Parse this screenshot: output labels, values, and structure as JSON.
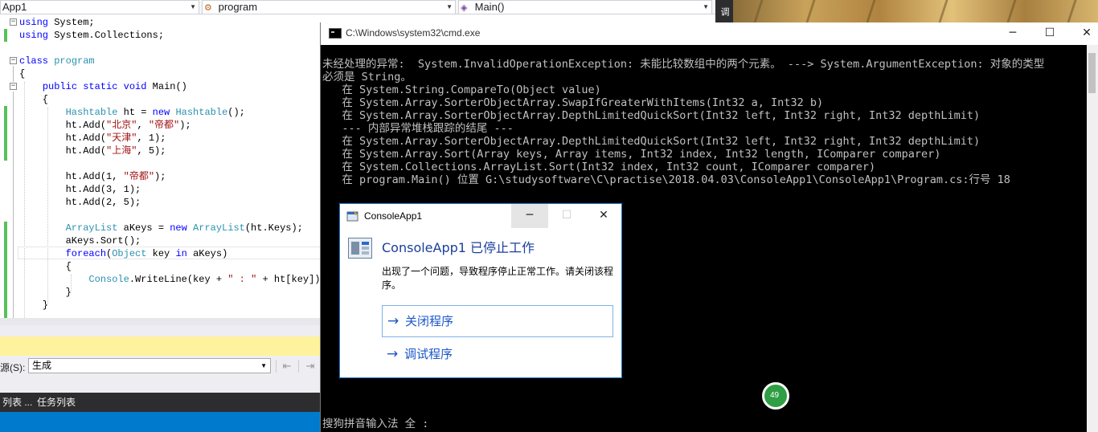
{
  "editor": {
    "nav": {
      "project": "App1",
      "class": "program",
      "member": "Main()"
    },
    "code_lines": [
      {
        "tokens": [
          {
            "t": "using",
            "c": "kw"
          },
          {
            "t": " System;",
            "c": ""
          }
        ]
      },
      {
        "tokens": [
          {
            "t": "using",
            "c": "kw"
          },
          {
            "t": " System.Collections;",
            "c": ""
          }
        ]
      },
      {
        "tokens": []
      },
      {
        "tokens": [
          {
            "t": "class",
            "c": "kw"
          },
          {
            "t": " ",
            "c": ""
          },
          {
            "t": "program",
            "c": "ty"
          }
        ]
      },
      {
        "tokens": [
          {
            "t": "{",
            "c": ""
          }
        ]
      },
      {
        "tokens": [
          {
            "t": "    ",
            "c": ""
          },
          {
            "t": "public",
            "c": "kw"
          },
          {
            "t": " ",
            "c": ""
          },
          {
            "t": "static",
            "c": "kw"
          },
          {
            "t": " ",
            "c": ""
          },
          {
            "t": "void",
            "c": "kw"
          },
          {
            "t": " Main()",
            "c": ""
          }
        ]
      },
      {
        "tokens": [
          {
            "t": "    {",
            "c": ""
          }
        ]
      },
      {
        "tokens": [
          {
            "t": "        ",
            "c": ""
          },
          {
            "t": "Hashtable",
            "c": "ty"
          },
          {
            "t": " ht = ",
            "c": ""
          },
          {
            "t": "new",
            "c": "kw"
          },
          {
            "t": " ",
            "c": ""
          },
          {
            "t": "Hashtable",
            "c": "ty"
          },
          {
            "t": "();",
            "c": ""
          }
        ]
      },
      {
        "tokens": [
          {
            "t": "        ht.Add(",
            "c": ""
          },
          {
            "t": "\"北京\"",
            "c": "st"
          },
          {
            "t": ", ",
            "c": ""
          },
          {
            "t": "\"帝都\"",
            "c": "st"
          },
          {
            "t": ");",
            "c": ""
          }
        ]
      },
      {
        "tokens": [
          {
            "t": "        ht.Add(",
            "c": ""
          },
          {
            "t": "\"天津\"",
            "c": "st"
          },
          {
            "t": ", 1);",
            "c": ""
          }
        ]
      },
      {
        "tokens": [
          {
            "t": "        ht.Add(",
            "c": ""
          },
          {
            "t": "\"上海\"",
            "c": "st"
          },
          {
            "t": ", 5);",
            "c": ""
          }
        ]
      },
      {
        "tokens": []
      },
      {
        "tokens": [
          {
            "t": "        ht.Add(1, ",
            "c": ""
          },
          {
            "t": "\"帝都\"",
            "c": "st"
          },
          {
            "t": ");",
            "c": ""
          }
        ]
      },
      {
        "tokens": [
          {
            "t": "        ht.Add(3, 1);",
            "c": ""
          }
        ]
      },
      {
        "tokens": [
          {
            "t": "        ht.Add(2, 5);",
            "c": ""
          }
        ]
      },
      {
        "tokens": []
      },
      {
        "tokens": [
          {
            "t": "        ",
            "c": ""
          },
          {
            "t": "ArrayList",
            "c": "ty"
          },
          {
            "t": " aKeys = ",
            "c": ""
          },
          {
            "t": "new",
            "c": "kw"
          },
          {
            "t": " ",
            "c": ""
          },
          {
            "t": "ArrayList",
            "c": "ty"
          },
          {
            "t": "(ht.Keys);",
            "c": ""
          }
        ]
      },
      {
        "tokens": [
          {
            "t": "        aKeys.Sort();",
            "c": ""
          }
        ]
      },
      {
        "tokens": [
          {
            "t": "        ",
            "c": ""
          },
          {
            "t": "foreach",
            "c": "kw"
          },
          {
            "t": "(",
            "c": ""
          },
          {
            "t": "Object",
            "c": "ty"
          },
          {
            "t": " key ",
            "c": ""
          },
          {
            "t": "in",
            "c": "kw"
          },
          {
            "t": " aKeys)",
            "c": ""
          }
        ]
      },
      {
        "tokens": [
          {
            "t": "        {",
            "c": ""
          }
        ]
      },
      {
        "tokens": [
          {
            "t": "            ",
            "c": ""
          },
          {
            "t": "Console",
            "c": "ty"
          },
          {
            "t": ".WriteLine(key + ",
            "c": ""
          },
          {
            "t": "\" : \"",
            "c": "st"
          },
          {
            "t": " + ht[key]);",
            "c": ""
          }
        ]
      },
      {
        "tokens": [
          {
            "t": "        }",
            "c": ""
          }
        ]
      },
      {
        "tokens": [
          {
            "t": "    }",
            "c": ""
          }
        ]
      }
    ]
  },
  "output_panel": {
    "source_label": "源(S):",
    "source_value": "生成"
  },
  "bottom_tabs": [
    "列表 ...",
    "任务列表"
  ],
  "side_strip_text": "调",
  "cmd": {
    "title": "C:\\Windows\\system32\\cmd.exe",
    "lines": [
      "未经处理的异常:  System.InvalidOperationException: 未能比较数组中的两个元素。 ---> System.ArgumentException: 对象的类型",
      "必须是 String。",
      "   在 System.String.CompareTo(Object value)",
      "   在 System.Array.SorterObjectArray.SwapIfGreaterWithItems(Int32 a, Int32 b)",
      "   在 System.Array.SorterObjectArray.DepthLimitedQuickSort(Int32 left, Int32 right, Int32 depthLimit)",
      "   --- 内部异常堆栈跟踪的结尾 ---",
      "   在 System.Array.SorterObjectArray.DepthLimitedQuickSort(Int32 left, Int32 right, Int32 depthLimit)",
      "   在 System.Array.Sort(Array keys, Array items, Int32 index, Int32 length, IComparer comparer)",
      "   在 System.Collections.ArrayList.Sort(Int32 index, Int32 count, IComparer comparer)",
      "   在 program.Main() 位置 G:\\studysoftware\\C\\practise\\2018.04.03\\ConsoleApp1\\ConsoleApp1\\Program.cs:行号 18"
    ],
    "ime_status": "搜狗拼音输入法 全 :",
    "badge_text": "49"
  },
  "dialog": {
    "title": "ConsoleApp1",
    "heading": "ConsoleApp1 已停止工作",
    "message": "出现了一个问题，导致程序停止正常工作。请关闭该程序。",
    "close_program": "关闭程序",
    "debug_program": "调试程序"
  },
  "colors": {
    "keyword": "#0000ff",
    "type": "#2b91af",
    "string": "#a31515",
    "change_bar": "#57c157",
    "status_bar": "#007acc",
    "dialog_heading": "#1a3f9b"
  }
}
